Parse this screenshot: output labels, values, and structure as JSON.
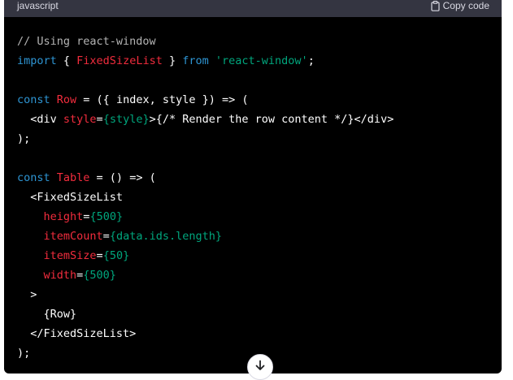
{
  "header": {
    "language": "javascript",
    "copy_label": "Copy code",
    "copy_icon": "clipboard-icon"
  },
  "code_lines": [
    [
      {
        "t": "// Using react-window",
        "c": "comment"
      }
    ],
    [
      {
        "t": "import",
        "c": "keyword"
      },
      {
        "t": " { ",
        "c": "plain"
      },
      {
        "t": "FixedSizeList",
        "c": "name"
      },
      {
        "t": " } ",
        "c": "plain"
      },
      {
        "t": "from",
        "c": "keyword"
      },
      {
        "t": " ",
        "c": "plain"
      },
      {
        "t": "'react-window'",
        "c": "string"
      },
      {
        "t": ";",
        "c": "plain"
      }
    ],
    [],
    [
      {
        "t": "const",
        "c": "keyword"
      },
      {
        "t": " ",
        "c": "plain"
      },
      {
        "t": "Row",
        "c": "name"
      },
      {
        "t": " = ({ index, style }) => (",
        "c": "plain"
      }
    ],
    [
      {
        "t": "  <div ",
        "c": "plain"
      },
      {
        "t": "style",
        "c": "name"
      },
      {
        "t": "=",
        "c": "plain"
      },
      {
        "t": "{style}",
        "c": "string"
      },
      {
        "t": ">{/* Render the row content */}</div>",
        "c": "plain"
      }
    ],
    [
      {
        "t": ");",
        "c": "plain"
      }
    ],
    [],
    [
      {
        "t": "const",
        "c": "keyword"
      },
      {
        "t": " ",
        "c": "plain"
      },
      {
        "t": "Table",
        "c": "name"
      },
      {
        "t": " = () => (",
        "c": "plain"
      }
    ],
    [
      {
        "t": "  <FixedSizeList",
        "c": "plain"
      }
    ],
    [
      {
        "t": "    ",
        "c": "plain"
      },
      {
        "t": "height",
        "c": "name"
      },
      {
        "t": "=",
        "c": "plain"
      },
      {
        "t": "{500}",
        "c": "string"
      }
    ],
    [
      {
        "t": "    ",
        "c": "plain"
      },
      {
        "t": "itemCount",
        "c": "name"
      },
      {
        "t": "=",
        "c": "plain"
      },
      {
        "t": "{data.ids.length}",
        "c": "string"
      }
    ],
    [
      {
        "t": "    ",
        "c": "plain"
      },
      {
        "t": "itemSize",
        "c": "name"
      },
      {
        "t": "=",
        "c": "plain"
      },
      {
        "t": "{50}",
        "c": "string"
      }
    ],
    [
      {
        "t": "    ",
        "c": "plain"
      },
      {
        "t": "width",
        "c": "name"
      },
      {
        "t": "=",
        "c": "plain"
      },
      {
        "t": "{500}",
        "c": "string"
      }
    ],
    [
      {
        "t": "  >",
        "c": "plain"
      }
    ],
    [
      {
        "t": "    {Row}",
        "c": "plain"
      }
    ],
    [
      {
        "t": "  </FixedSizeList>",
        "c": "plain"
      }
    ],
    [
      {
        "t": ");",
        "c": "plain"
      }
    ]
  ],
  "scroll_button": {
    "icon": "arrow-down-icon"
  },
  "colors": {
    "code_background": "#000000",
    "header_background": "#343541",
    "keyword": "#2e95d3",
    "name": "#f22c3d",
    "string": "#00a67d",
    "comment": "#b4b4b4"
  }
}
